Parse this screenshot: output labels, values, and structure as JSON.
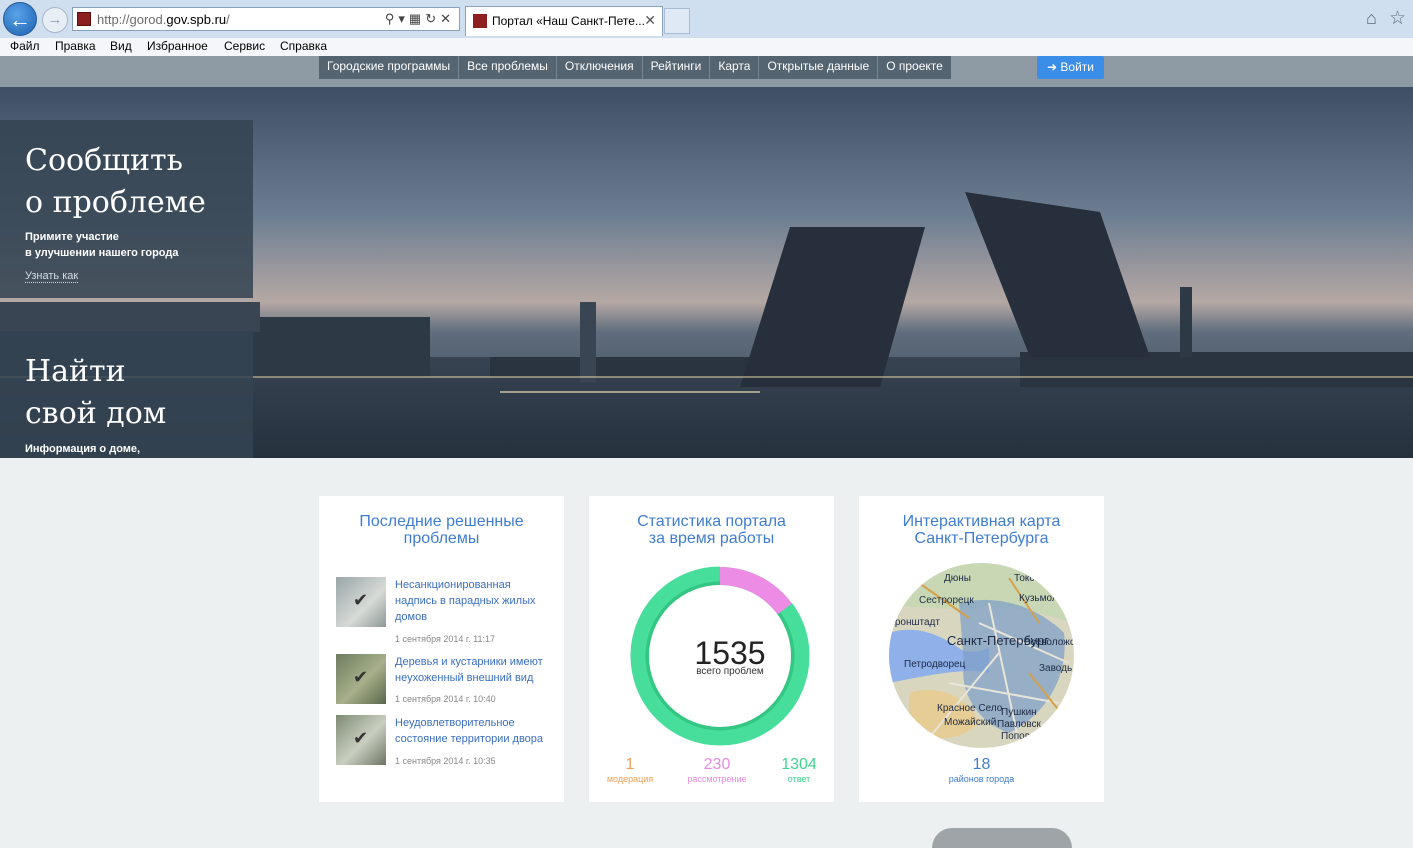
{
  "browser": {
    "url_prefix": "http://gorod.",
    "url_domain": "gov.spb.ru",
    "url_suffix": "/",
    "tab_title": "Портал «Наш Санкт-Пете...",
    "menu": [
      "Файл",
      "Правка",
      "Вид",
      "Избранное",
      "Сервис",
      "Справка"
    ]
  },
  "nav": {
    "items": [
      "Городские программы",
      "Все проблемы",
      "Отключения",
      "Рейтинги",
      "Карта",
      "Открытые данные",
      "О проекте"
    ],
    "login": "Войти"
  },
  "hero": {
    "report": {
      "title_line1": "Сообщить",
      "title_line2": "о проблеме",
      "sub_line1": "Примите участие",
      "sub_line2": "в улучшении нашего города",
      "link": "Узнать как"
    },
    "house": {
      "title_line1": "Найти",
      "title_line2": "свой дом",
      "sub_line1": "Информация о доме,"
    }
  },
  "recent": {
    "title_line1": "Последние решенные",
    "title_line2": "проблемы",
    "items": [
      {
        "title": "Несанкционированная надпись в парадных жилых домов",
        "date": "1 сентября 2014 г. 11:17"
      },
      {
        "title": "Деревья и кустарники имеют неухоженный внешний вид",
        "date": "1 сентября 2014 г. 10:40"
      },
      {
        "title": "Неудовлетворительное состояние территории двора",
        "date": "1 сентября 2014 г. 10:35"
      }
    ]
  },
  "stats": {
    "title_line1": "Статистика портала",
    "title_line2": "за время работы",
    "total": "1535",
    "total_label": "всего проблем",
    "moderation": {
      "value": "1",
      "label": "модерация",
      "color": "#f0a15a"
    },
    "review": {
      "value": "230",
      "label": "рассмотрение",
      "color": "#e98be0"
    },
    "answer": {
      "value": "1304",
      "label": "ответ",
      "color": "#3fd48e"
    }
  },
  "map": {
    "title_line1": "Интерактивная карта",
    "title_line2": "Санкт-Петербурга",
    "districts": "18",
    "districts_label": "районов города",
    "places": [
      "Дюны",
      "Токсово",
      "Сестрорецк",
      "Кузьмоловский",
      "Кронштадт",
      "Всеволожск",
      "Санкт-Петербург",
      "Петродворец",
      "Заводь",
      "Красное Село",
      "Пушкин",
      "Можайский",
      "Павловск",
      "Попово"
    ]
  }
}
